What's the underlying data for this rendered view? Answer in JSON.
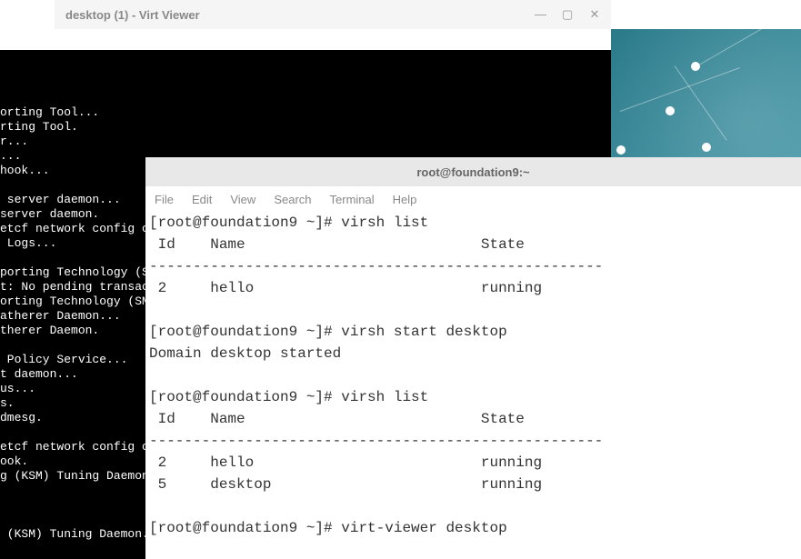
{
  "virt_viewer": {
    "title": "desktop (1) - Virt Viewer",
    "controls": {
      "min": "—",
      "max": "▢",
      "close": "✕"
    },
    "console_lines": [
      "",
      "orting Tool...",
      "rting Tool.",
      "r...",
      "...",
      "hook...",
      "",
      " server daemon...",
      "server daemon.",
      "etcf network config c...",
      " Logs...",
      "",
      "porting Technology (SMART",
      "t: No pending transaction",
      "orting Technology (SMART",
      "atherer Daemon...",
      "therer Daemon.",
      "",
      " Policy Service...",
      "t daemon...",
      "us...",
      "s.",
      "dmesg.",
      "",
      "etcf network config chang",
      "ook.",
      "g (KSM) Tuning Daemon...",
      "",
      "",
      "",
      " (KSM) Tuning Daemon."
    ]
  },
  "terminal": {
    "title": "root@foundation9:~",
    "menu": {
      "file": "File",
      "edit": "Edit",
      "view": "View",
      "search": "Search",
      "terminal": "Terminal",
      "help": "Help"
    },
    "lines": [
      "[root@foundation9 ~]# virsh list",
      " Id    Name                           State",
      "----------------------------------------------------",
      " 2     hello                          running",
      "",
      "[root@foundation9 ~]# virsh start desktop",
      "Domain desktop started",
      "",
      "[root@foundation9 ~]# virsh list",
      " Id    Name                           State",
      "----------------------------------------------------",
      " 2     hello                          running",
      " 5     desktop                        running",
      "",
      "[root@foundation9 ~]# virt-viewer desktop"
    ]
  }
}
